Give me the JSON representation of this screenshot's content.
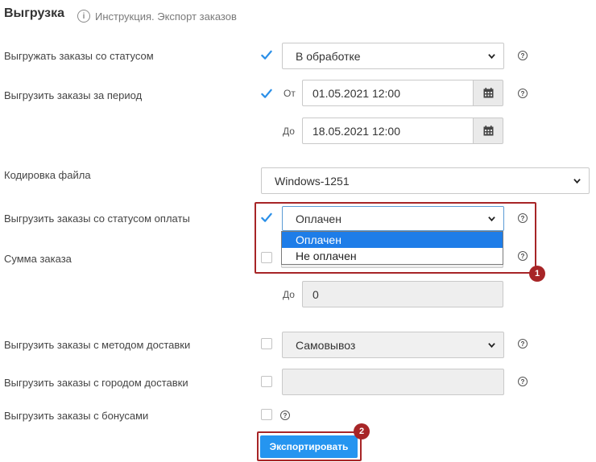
{
  "header": {
    "title": "Выгрузка",
    "info_link": "Инструкция. Экспорт заказов"
  },
  "rows": {
    "status": {
      "label": "Выгружать заказы со статусом",
      "checked": true,
      "value": "В обработке"
    },
    "period": {
      "label": "Выгрузить заказы за период",
      "checked": true,
      "from_label": "От",
      "from_value": "01.05.2021 12:00",
      "to_label": "До",
      "to_value": "18.05.2021 12:00"
    },
    "encoding": {
      "label": "Кодировка файла",
      "value": "Windows-1251"
    },
    "payment_status": {
      "label": "Выгрузить заказы со статусом оплаты",
      "checked": true,
      "value": "Оплачен",
      "options": [
        "Оплачен",
        "Не оплачен"
      ],
      "highlighted_option": "Оплачен"
    },
    "order_sum": {
      "label": "Сумма заказа",
      "checked": false,
      "to_label": "До",
      "to_value": "0"
    },
    "delivery_method": {
      "label": "Выгрузить заказы с методом доставки",
      "checked": false,
      "value": "Самовывоз"
    },
    "delivery_city": {
      "label": "Выгрузить заказы с городом доставки",
      "checked": false,
      "value": ""
    },
    "bonuses": {
      "label": "Выгрузить заказы с бонусами",
      "checked": false
    }
  },
  "actions": {
    "export_label": "Экспортировать"
  },
  "annotations": {
    "badge_1": "1",
    "badge_2": "2"
  },
  "icons": {
    "help": "?",
    "info": "i",
    "calendar": "calendar-icon",
    "chevron": "chevron-down-icon"
  },
  "colors": {
    "accent": "#2595f0",
    "checkbox": "#2a8fe8",
    "annotation": "#a72527",
    "dropdown_selected": "#1e7de8"
  }
}
